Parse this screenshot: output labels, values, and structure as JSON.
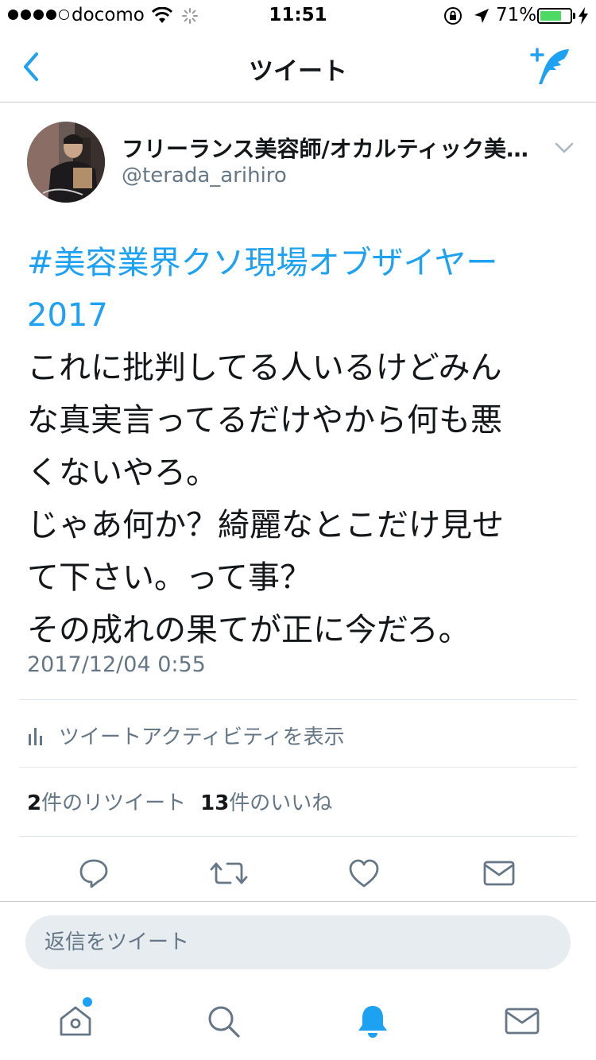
{
  "status_bar": {
    "carrier": "docomo",
    "time": "11:51",
    "battery_percent": "71%",
    "battery_level": 0.71
  },
  "nav": {
    "title": "ツイート",
    "back_icon": "chevron-left-icon",
    "compose_icon": "compose-tweet-icon"
  },
  "tweet": {
    "display_name": "フリーランス美容師/オカルティック美…",
    "handle": "@terada_arihiro",
    "hashtag": "#美容業界クソ現場オブザイヤー",
    "hashtag_cont": "2017",
    "lines": [
      "これに批判してる人いるけどみん",
      "な真実言ってるだけやから何も悪",
      "くないやろ。",
      "じゃあ何か？綺麗なとこだけ見せ",
      "て下さい。って事？",
      "その成れの果てが正に今だろ。"
    ],
    "timestamp": "2017/12/04 0:55"
  },
  "activity": {
    "label": "ツイートアクティビティを表示"
  },
  "stats": {
    "retweet_count": "2",
    "retweet_label": "件のリツイート",
    "like_count": "13",
    "like_label": "件のいいね"
  },
  "reply": {
    "placeholder": "返信をツイート"
  },
  "colors": {
    "accent": "#1da1f2",
    "text": "#14171a",
    "secondary": "#657786",
    "divider": "#e1e8ed",
    "battery": "#4cd964"
  }
}
